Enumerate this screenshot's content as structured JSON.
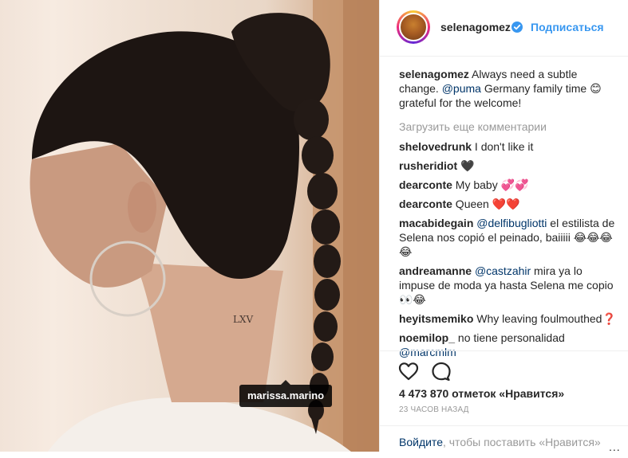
{
  "post": {
    "tagged_user": "marissa.marino"
  },
  "header": {
    "username": "selenagomez",
    "follow_label": "Подписаться"
  },
  "caption": {
    "username": "selenagomez",
    "text_1": " Always need a subtle change. ",
    "mention": "@puma",
    "text_2": " Germany family time 😊 grateful for the welcome!"
  },
  "load_more": "Загрузить еще комментарии",
  "comments": [
    {
      "user": "shelovedrunk",
      "text": " I don't like it"
    },
    {
      "user": "rusheridiot",
      "text": " 🖤"
    },
    {
      "user": "dearconte",
      "text": " My baby 💞💞"
    },
    {
      "user": "dearconte",
      "text": " Queen ❤️❤️"
    },
    {
      "user": "macabidegain",
      "mention": "@delfibugliotti",
      "text": " el estilista de Selena nos copió el peinado, baiiiii 😂😂😂😂"
    },
    {
      "user": "andreamanne",
      "mention": "@castzahir",
      "text": " mira ya lo impuse de moda ya hasta Selena me copio 👀😂"
    },
    {
      "user": "heyitsmemiko",
      "text": " Why leaving foulmouthed❓"
    },
    {
      "user": "noemilop_",
      "text": " no tiene personalidad ",
      "mention_after": "@marcmlm"
    }
  ],
  "likes": "4 473 870 отметок «Нравится»",
  "time_ago": "23 ЧАСОВ НАЗАД",
  "login": {
    "link": "Войдите",
    "text": ", чтобы поставить «Нравится»",
    "more": "..."
  },
  "colors": {
    "accent": "#3897f0",
    "mention": "#003569",
    "muted": "#999999",
    "text": "#262626"
  },
  "icons": [
    "heart-icon",
    "comment-icon",
    "verified-badge-icon"
  ]
}
